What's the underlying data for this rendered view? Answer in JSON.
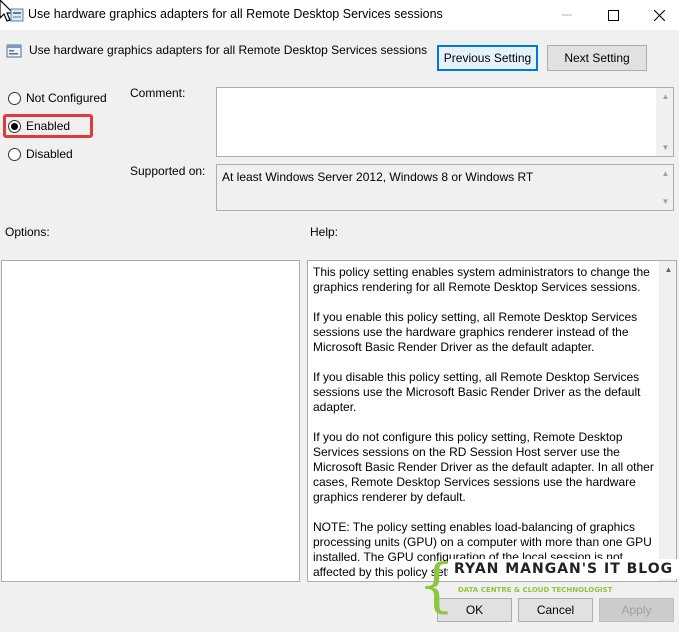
{
  "window": {
    "title": "Use hardware graphics adapters for all Remote Desktop Services sessions",
    "minimize_icon": "minimize-icon",
    "maximize_icon": "maximize-icon",
    "close_icon": "close-icon"
  },
  "header": {
    "policy_name": "Use hardware graphics adapters for all Remote Desktop Services sessions",
    "previous_label": "Previous Setting",
    "next_label": "Next Setting"
  },
  "state": {
    "options": [
      {
        "label": "Not Configured",
        "checked": false
      },
      {
        "label": "Enabled",
        "checked": true
      },
      {
        "label": "Disabled",
        "checked": false
      }
    ]
  },
  "comment": {
    "label": "Comment:",
    "value": ""
  },
  "supported": {
    "label": "Supported on:",
    "value": "At least Windows Server 2012, Windows 8 or Windows RT"
  },
  "options_label": "Options:",
  "help": {
    "label": "Help:",
    "paragraphs": [
      "This policy setting enables system administrators to change the graphics rendering for all Remote Desktop Services sessions.",
      "If you enable this policy setting, all Remote Desktop Services sessions use the hardware graphics renderer instead of the Microsoft Basic Render Driver as the default adapter.",
      "If you disable this policy setting, all Remote Desktop Services sessions use the Microsoft Basic Render Driver as the default adapter.",
      "If you do not configure this policy setting, Remote Desktop Services sessions on the RD Session Host server use the Microsoft Basic Render Driver as the default adapter. In all other cases, Remote Desktop Services sessions use the hardware graphics renderer by default.",
      "NOTE: The policy setting enables load-balancing of graphics processing units (GPU) on a computer with more than one GPU installed. The GPU configuration of the local session is not affected by this policy setting."
    ]
  },
  "footer": {
    "ok_label": "OK",
    "cancel_label": "Cancel",
    "apply_label": "Apply"
  },
  "watermark": {
    "title": "RYAN MANGAN'S IT BLOG",
    "subtitle": "DATA CENTRE & CLOUD TECHNOLOGIST"
  },
  "colors": {
    "focus_border": "#0078d7",
    "highlight_red": "#e03a3a",
    "watermark_green": "#8dc63f"
  }
}
